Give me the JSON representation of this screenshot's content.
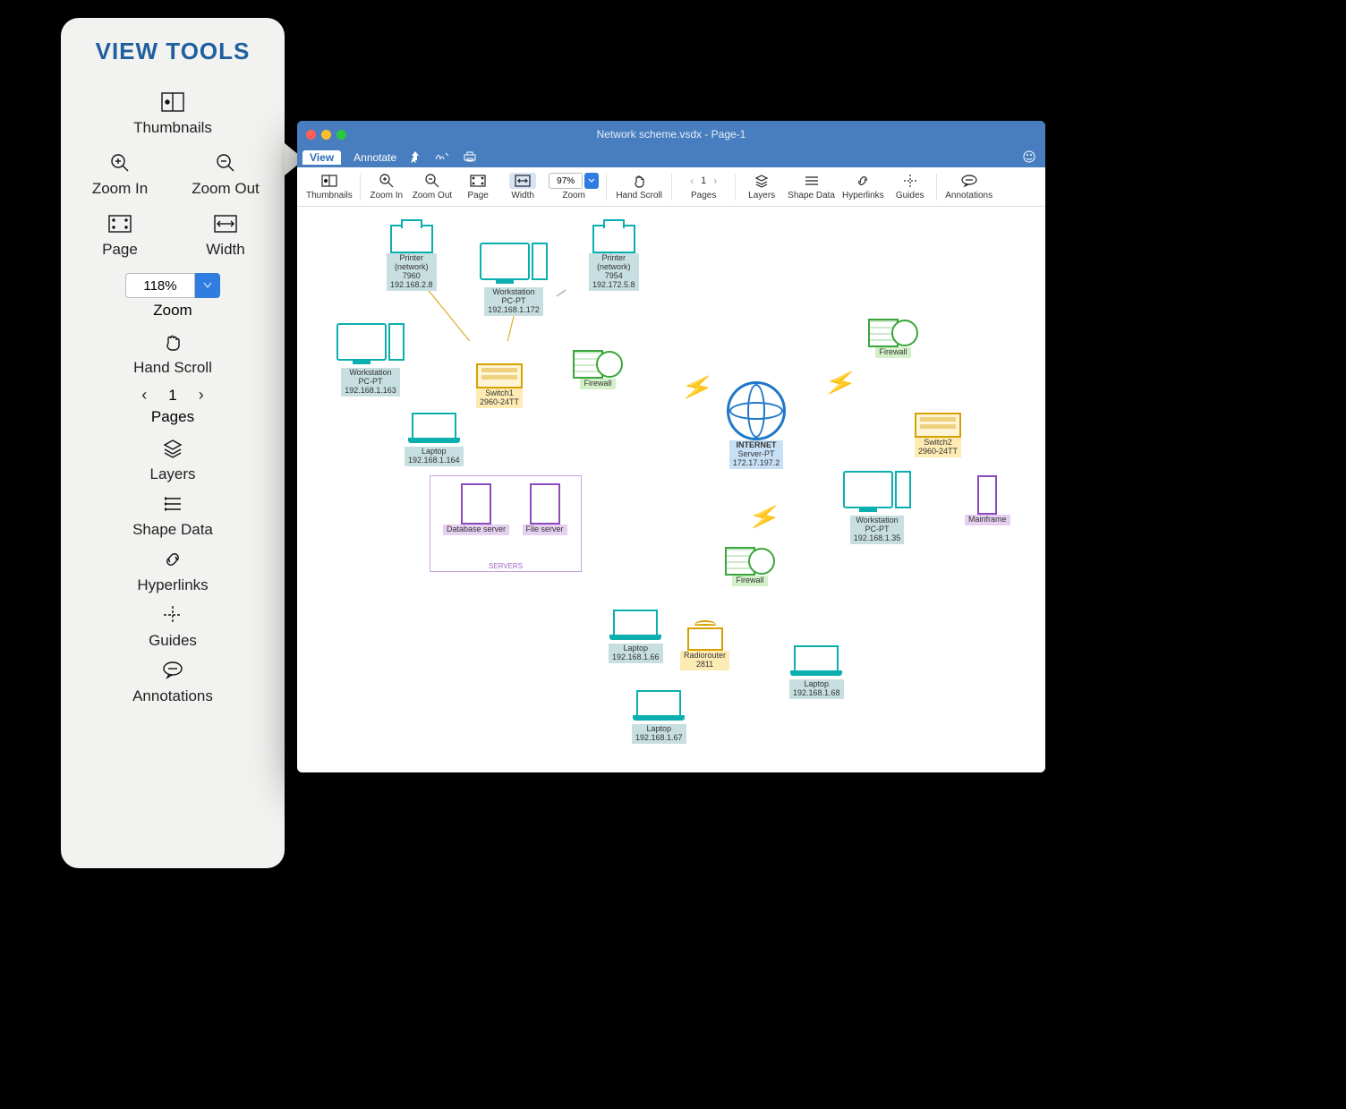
{
  "side_panel": {
    "title": "VIEW TOOLS",
    "thumbnails": "Thumbnails",
    "zoom_in": "Zoom In",
    "zoom_out": "Zoom Out",
    "page": "Page",
    "width": "Width",
    "zoom_value": "118%",
    "zoom_label": "Zoom",
    "hand_scroll": "Hand Scroll",
    "page_num": "1",
    "pages": "Pages",
    "layers": "Layers",
    "shape_data": "Shape Data",
    "hyperlinks": "Hyperlinks",
    "guides": "Guides",
    "annotations": "Annotations"
  },
  "app": {
    "title": "Network scheme.vsdx - Page-1",
    "menu": {
      "view": "View",
      "annotate": "Annotate"
    },
    "toolbar": {
      "thumbnails": "Thumbnails",
      "zoom_in": "Zoom In",
      "zoom_out": "Zoom Out",
      "page": "Page",
      "width": "Width",
      "zoom_value": "97%",
      "zoom_label": "Zoom",
      "hand_scroll": "Hand Scroll",
      "page_num": "1",
      "pages": "Pages",
      "layers": "Layers",
      "shape_data": "Shape Data",
      "hyperlinks": "Hyperlinks",
      "guides": "Guides",
      "annotations": "Annotations"
    }
  },
  "diagram": {
    "servers_caption": "SERVERS",
    "nodes": {
      "printer1": {
        "l1": "Printer",
        "l2": "(network)",
        "l3": "7960",
        "l4": "192.168.2.8"
      },
      "printer2": {
        "l1": "Printer",
        "l2": "(network)",
        "l3": "7954",
        "l4": "192.172.5.8"
      },
      "ws1": {
        "l1": "Workstation",
        "l2": "PC-PT",
        "l3": "192.168.1.172"
      },
      "ws2": {
        "l1": "Workstation",
        "l2": "PC-PT",
        "l3": "192.168.1.163"
      },
      "ws3": {
        "l1": "Workstation",
        "l2": "PC-PT",
        "l3": "192.168.1.35"
      },
      "lap1": {
        "l1": "Laptop",
        "l2": "192.168.1.164"
      },
      "lap2": {
        "l1": "Laptop",
        "l2": "192.168.1.66"
      },
      "lap3": {
        "l1": "Laptop",
        "l2": "192.168.1.67"
      },
      "lap4": {
        "l1": "Laptop",
        "l2": "192.168.1.68"
      },
      "sw1": {
        "l1": "Switch1",
        "l2": "2960-24TT"
      },
      "sw2": {
        "l1": "Switch2",
        "l2": "2960-24TT"
      },
      "fw1": {
        "l1": "Firewall"
      },
      "fw2": {
        "l1": "Firewall"
      },
      "fw3": {
        "l1": "Firewall"
      },
      "inet": {
        "l1": "INTERNET",
        "l2": "Server-PT",
        "l3": "172.17.197.2"
      },
      "db": {
        "l1": "Database server"
      },
      "fs": {
        "l1": "File server"
      },
      "mf": {
        "l1": "Mainframe"
      },
      "rr": {
        "l1": "Radiorouter",
        "l2": "2811"
      }
    }
  }
}
